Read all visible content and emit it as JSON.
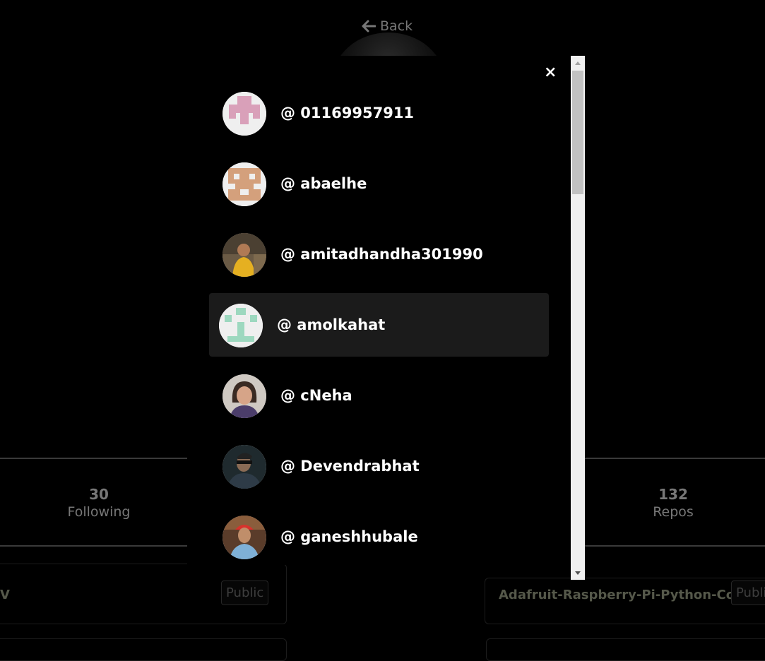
{
  "header": {
    "back_label": "Back"
  },
  "stats": {
    "following": {
      "value": "30",
      "label": "Following"
    },
    "repos": {
      "value": "132",
      "label": "Repos"
    }
  },
  "repos": [
    {
      "name": "V",
      "visibility": "Public"
    },
    {
      "name": "Adafruit-Raspberry-Pi-Python-Code",
      "visibility": "Publi"
    }
  ],
  "modal": {
    "close_label": "×",
    "users": [
      {
        "handle": "@ 01169957911",
        "avatar": "identicon-pink"
      },
      {
        "handle": "@ abaelhe",
        "avatar": "identicon-tan"
      },
      {
        "handle": "@ amitadhandha301990",
        "avatar": "photo"
      },
      {
        "handle": "@ amolkahat",
        "avatar": "identicon-green",
        "highlighted": true
      },
      {
        "handle": "@ cNeha",
        "avatar": "photo"
      },
      {
        "handle": "@ Devendrabhat",
        "avatar": "photo"
      },
      {
        "handle": "@ ganeshhubale",
        "avatar": "photo"
      }
    ]
  },
  "colors": {
    "background": "#000000",
    "highlight": "#1b1b1b",
    "scrollbar": "#f0f0f0"
  }
}
